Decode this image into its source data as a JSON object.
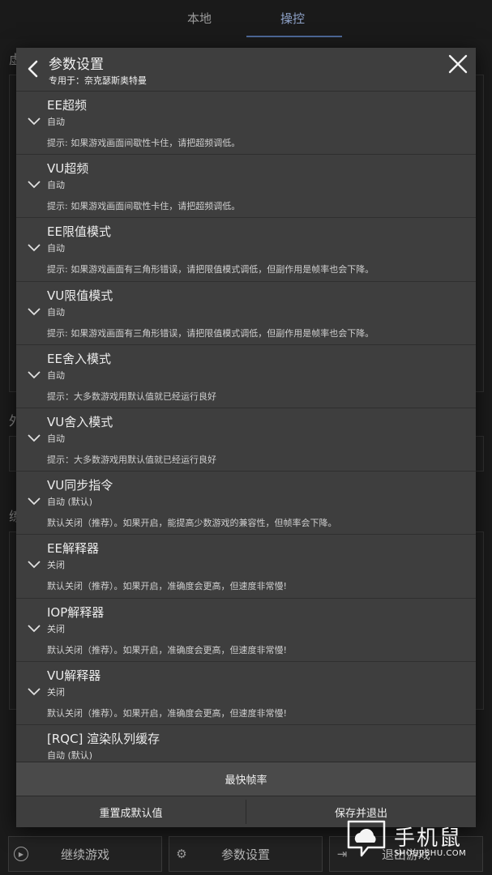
{
  "background": {
    "tabs": [
      {
        "label": "本地",
        "active": false
      },
      {
        "label": "操控",
        "active": true
      }
    ],
    "side_chars": [
      "虚",
      "外",
      "练"
    ],
    "bottom_buttons": [
      {
        "label": "继续游戏",
        "icon": "play-circle-icon"
      },
      {
        "label": "参数设置",
        "icon": "gear-icon"
      },
      {
        "label": "退出游戏",
        "icon": "exit-icon"
      }
    ]
  },
  "dialog": {
    "title": "参数设置",
    "subtitle": "专用于：奈克瑟斯奥特曼",
    "settings": [
      {
        "title": "EE超频",
        "value": "自动",
        "hint": "提示: 如果游戏画面间歇性卡住，请把超频调低。"
      },
      {
        "title": "VU超频",
        "value": "自动",
        "hint": "提示: 如果游戏画面间歇性卡住，请把超频调低。"
      },
      {
        "title": "EE限值模式",
        "value": "自动",
        "hint": "提示: 如果游戏画面有三角形错误，请把限值模式调低，但副作用是帧率也会下降。"
      },
      {
        "title": "VU限值模式",
        "value": "自动",
        "hint": "提示: 如果游戏画面有三角形错误，请把限值模式调低，但副作用是帧率也会下降。"
      },
      {
        "title": "EE舍入模式",
        "value": "自动",
        "hint": "提示：大多数游戏用默认值就已经运行良好"
      },
      {
        "title": "VU舍入模式",
        "value": "自动",
        "hint": "提示：大多数游戏用默认值就已经运行良好"
      },
      {
        "title": "VU同步指令",
        "value": "自动 (默认)",
        "hint": "默认关闭（推荐）。如果开启，能提高少数游戏的兼容性，但帧率会下降。"
      },
      {
        "title": "EE解释器",
        "value": "关闭",
        "hint": "默认关闭（推荐）。如果开启，准确度会更高，但速度非常慢!"
      },
      {
        "title": "IOP解释器",
        "value": "关闭",
        "hint": "默认关闭（推荐）。如果开启，准确度会更高，但速度非常慢!"
      },
      {
        "title": "VU解释器",
        "value": "关闭",
        "hint": "默认关闭（推荐）。如果开启，准确度会更高，但速度非常慢!"
      },
      {
        "title": "[RQC] 渲染队列缓存",
        "value": "自动 (默认)",
        "hint": ""
      }
    ],
    "fps_label": "最快帧率",
    "reset_label": "重置成默认值",
    "save_label": "保存并退出"
  },
  "watermark": {
    "main": "手机鼠",
    "sub": "SHOUJISHU.COM"
  },
  "colors": {
    "dialog_bg": "#3e3e3e",
    "page_bg": "#1b1b1b",
    "active_tab": "#8ea2c8"
  }
}
